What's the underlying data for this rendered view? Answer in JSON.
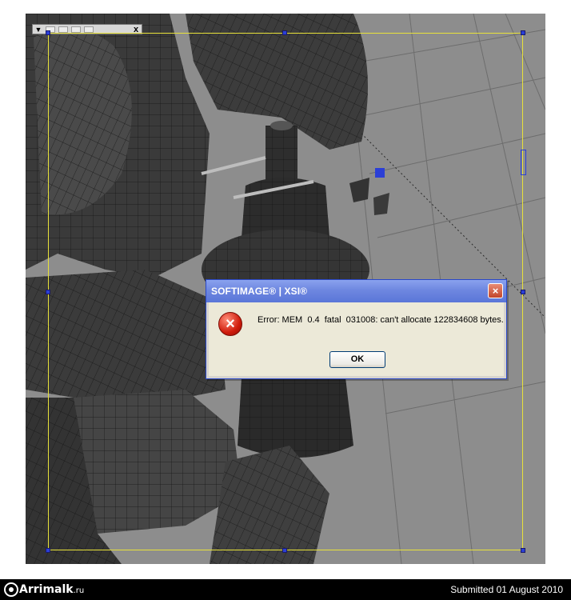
{
  "viewport": {
    "toolbar": {
      "expand_glyph": "▼",
      "close_glyph": "x"
    },
    "background_color": "#8d8d8d",
    "frame_color": "#e8e23a",
    "handle_color": "#2b3fd6"
  },
  "dialog": {
    "title": "SOFTIMAGE® | XSI®",
    "close_glyph": "×",
    "icon": "error-icon",
    "icon_glyph": "×",
    "message": "Error: MEM  0.4  fatal  031008: can't allocate 122834608 bytes.",
    "ok_label": "OK"
  },
  "footer": {
    "logo_text": "Arrimalk",
    "logo_suffix": ".ru",
    "submitted": "Submitted 01 August 2010"
  }
}
